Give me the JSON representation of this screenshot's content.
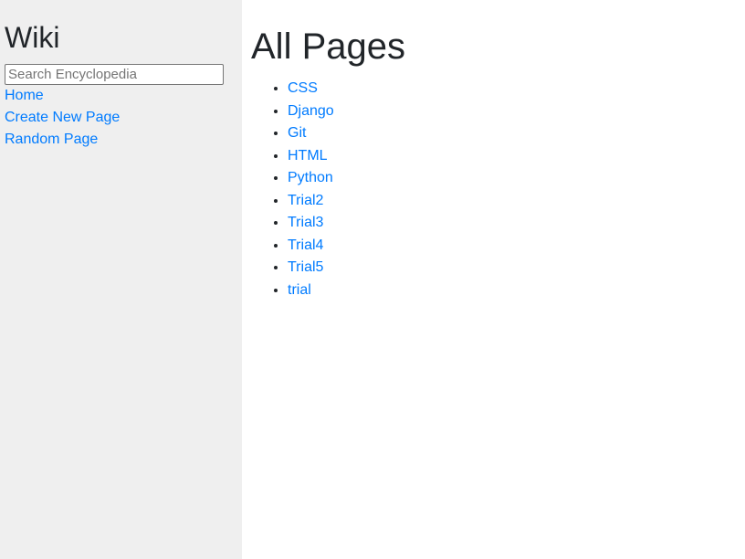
{
  "sidebar": {
    "brand": "Wiki",
    "search": {
      "placeholder": "Search Encyclopedia",
      "value": ""
    },
    "links": [
      {
        "label": "Home"
      },
      {
        "label": "Create New Page"
      },
      {
        "label": "Random Page"
      }
    ]
  },
  "main": {
    "title": "All Pages",
    "entries": [
      "CSS",
      "Django",
      "Git",
      "HTML",
      "Python",
      "Trial2",
      "Trial3",
      "Trial4",
      "Trial5",
      "trial"
    ]
  },
  "colors": {
    "link": "#007bff",
    "sidebar_bg": "#efefef",
    "text": "#212529"
  }
}
